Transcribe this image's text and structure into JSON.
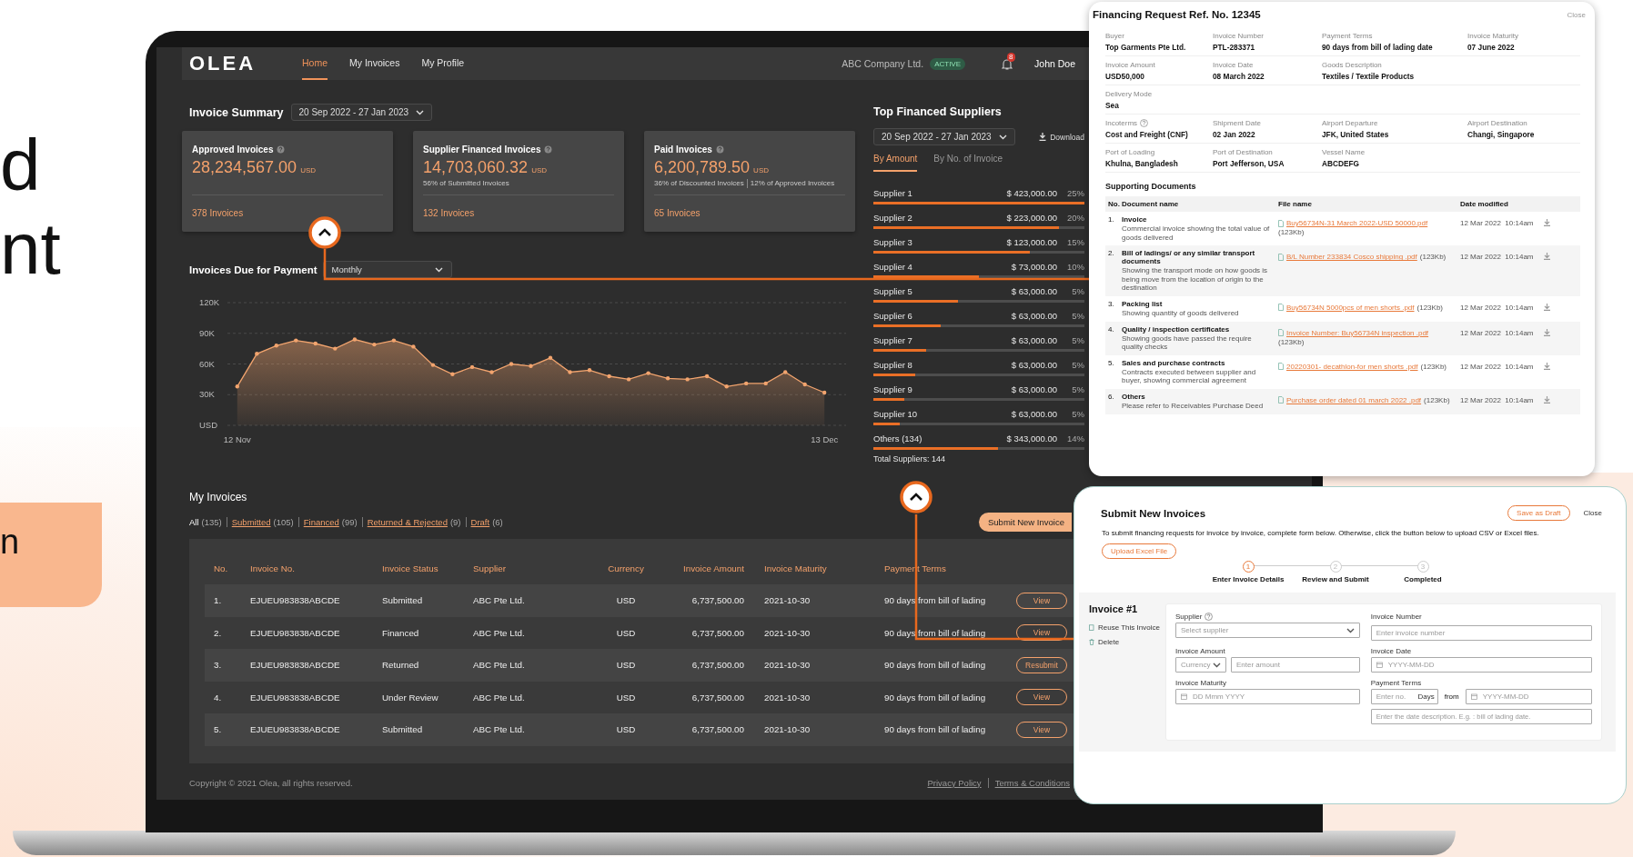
{
  "hero": {
    "lines": [
      "d",
      "nt"
    ],
    "highlight": "n"
  },
  "nav": {
    "logo": "OLEA",
    "tabs": [
      {
        "label": "Home",
        "selected": true
      },
      {
        "label": "My Invoices",
        "selected": false
      },
      {
        "label": "My Profile",
        "selected": false
      }
    ],
    "company": "ABC Company Ltd.",
    "status": "ACTIVE",
    "notifications": "8",
    "user": "John Doe"
  },
  "invoice_summary": {
    "title": "Invoice Summary",
    "date_range": "20 Sep 2022 - 27 Jan 2023",
    "cards": [
      {
        "title": "Approved Invoices",
        "amount": "28,234,567.00",
        "currency": "USD",
        "link": "378 Invoices"
      },
      {
        "title": "Supplier Financed Invoices",
        "amount": "14,703,060.32",
        "currency": "USD",
        "notes": [
          "56% of Submitted Invoices"
        ],
        "link": "132 Invoices"
      },
      {
        "title": "Paid Invoices",
        "amount": "6,200,789.50",
        "currency": "USD",
        "notes": [
          "36% of Discounted Invoices",
          "12% of Approved Invoices"
        ],
        "link": "65 Invoices"
      }
    ]
  },
  "invoices_due": {
    "title": "Invoices Due for Payment",
    "period": "Monthly",
    "chart_data": {
      "type": "area",
      "categories": [
        "12 Nov",
        null,
        null,
        null,
        null,
        null,
        null,
        null,
        null,
        null,
        null,
        null,
        null,
        null,
        null,
        null,
        null,
        null,
        null,
        null,
        null,
        null,
        null,
        null,
        null,
        null,
        null,
        null,
        null,
        null,
        "13 Dec"
      ],
      "series": [
        {
          "color": "#f2a46e",
          "values": [
            38000,
            70000,
            78000,
            83000,
            80000,
            75000,
            84000,
            79000,
            83000,
            77000,
            59000,
            50000,
            57000,
            52000,
            60000,
            58000,
            66000,
            52000,
            54000,
            48000,
            45000,
            51000,
            46000,
            45000,
            48000,
            38000,
            41000,
            41000,
            52000,
            40000,
            32000
          ]
        }
      ],
      "ylim": [
        0,
        120000
      ],
      "grid": true,
      "yticks": [
        {
          "value": 0,
          "label": "USD"
        },
        {
          "value": 30000,
          "label": "30K"
        },
        {
          "value": 60000,
          "label": "60K"
        },
        {
          "value": 90000,
          "label": "90K"
        },
        {
          "value": 120000,
          "label": "120K"
        }
      ]
    }
  },
  "top_suppliers": {
    "title": "Top Financed Suppliers",
    "date_range": "20 Sep 2022 - 27 Jan 2023",
    "download": "Download",
    "tabs": [
      {
        "label": "By Amount",
        "selected": true
      },
      {
        "label": "By No. of Invoice",
        "selected": false
      }
    ],
    "rows": [
      {
        "name": "Supplier 1",
        "amount": "$ 423,000.00",
        "share": "25%",
        "level": 1.0
      },
      {
        "name": "Supplier 2",
        "amount": "$ 223,000.00",
        "share": "20%",
        "level": 0.88
      },
      {
        "name": "Supplier 3",
        "amount": "$ 123,000.00",
        "share": "15%",
        "level": 0.74
      },
      {
        "name": "Supplier 4",
        "amount": "$ 73,000.00",
        "share": "10%",
        "level": 0.5
      },
      {
        "name": "Supplier 5",
        "amount": "$ 63,000.00",
        "share": "5%",
        "level": 0.4
      },
      {
        "name": "Supplier 6",
        "amount": "$ 63,000.00",
        "share": "5%",
        "level": 0.32
      },
      {
        "name": "Supplier 7",
        "amount": "$ 63,000.00",
        "share": "5%",
        "level": 0.25
      },
      {
        "name": "Supplier 8",
        "amount": "$ 63,000.00",
        "share": "5%",
        "level": 0.2
      },
      {
        "name": "Supplier 9",
        "amount": "$ 63,000.00",
        "share": "5%",
        "level": 0.145
      },
      {
        "name": "Supplier 10",
        "amount": "$ 63,000.00",
        "share": "5%",
        "level": 0.125
      },
      {
        "name": "Others (134)",
        "amount": "$ 343,000.00",
        "share": "14%",
        "level": 0.59
      }
    ],
    "total": "Total Suppliers: 144"
  },
  "my_invoices": {
    "title": "My Invoices",
    "filters": [
      {
        "label": "All",
        "count": "(135)",
        "selected": true
      },
      {
        "label": "Submitted",
        "count": "(105)",
        "selected": false
      },
      {
        "label": "Financed",
        "count": "(99)",
        "selected": false
      },
      {
        "label": "Returned & Rejected",
        "count": "(9)",
        "selected": false
      },
      {
        "label": "Draft",
        "count": "(6)",
        "selected": false
      }
    ],
    "submit_button": "Submit New Invoice",
    "columns": [
      "No.",
      "Invoice No.",
      "Invoice Status",
      "Supplier",
      "Currency",
      "Invoice Amount",
      "Invoice Maturity",
      "Payment Terms"
    ],
    "rows": [
      {
        "cells": [
          "1.",
          "EJUEU983838ABCDE",
          "Submitted",
          "ABC Pte Ltd.",
          "USD",
          "6,737,500.00",
          "2021-10-30",
          "90 days from bill of lading"
        ],
        "action": "View"
      },
      {
        "cells": [
          "2.",
          "EJUEU983838ABCDE",
          "Financed",
          "ABC Pte Ltd.",
          "USD",
          "6,737,500.00",
          "2021-10-30",
          "90 days from bill of lading"
        ],
        "action": "View"
      },
      {
        "cells": [
          "3.",
          "EJUEU983838ABCDE",
          "Returned",
          "ABC Pte Ltd.",
          "USD",
          "6,737,500.00",
          "2021-10-30",
          "90 days from bill of lading"
        ],
        "action": "Resubmit"
      },
      {
        "cells": [
          "4.",
          "EJUEU983838ABCDE",
          "Under Review",
          "ABC Pte Ltd.",
          "USD",
          "6,737,500.00",
          "2021-10-30",
          "90 days from bill of lading"
        ],
        "action": "View"
      },
      {
        "cells": [
          "5.",
          "EJUEU983838ABCDE",
          "Submitted",
          "ABC Pte Ltd.",
          "USD",
          "6,737,500.00",
          "2021-10-30",
          "90 days from bill of lading"
        ],
        "action": "View"
      }
    ]
  },
  "footer": {
    "copyright": "Copyright © 2021 Olea, all rights reserved.",
    "links": [
      "Privacy Policy",
      "Terms & Conditions"
    ]
  },
  "financing_request": {
    "title": "Financing Request Ref. No. 12345",
    "close": "Close",
    "field_rows": [
      {
        "fields": [
          {
            "label": "Buyer",
            "value": "Top Garments Pte Ltd.",
            "help": false
          },
          {
            "label": "Invoice Number",
            "value": "PTL-283371",
            "help": false
          },
          {
            "label": "Payment Terms",
            "value": "90 days from bill of lading date",
            "help": false
          },
          {
            "label": "Invoice Maturity",
            "value": "07 June 2022",
            "help": false
          }
        ]
      },
      {
        "fields": [
          {
            "label": "Invoice Amount",
            "value": "USD50,000",
            "help": false
          },
          {
            "label": "Invoice Date",
            "value": "08 March 2022",
            "help": false
          },
          {
            "label": "Goods Description",
            "value": "Textiles / Textile Products",
            "help": false
          }
        ]
      },
      {
        "fields": [
          {
            "label": "Delivery Mode",
            "value": "Sea",
            "help": false
          }
        ]
      },
      {
        "fields": [
          {
            "label": "Incoterms",
            "value": "Cost and Freight  (CNF)",
            "help": true
          },
          {
            "label": "Shipment Date",
            "value": "02 Jan 2022",
            "help": false
          },
          {
            "label": "Airport Departure",
            "value": "JFK, United States",
            "help": false
          },
          {
            "label": "Airport Destination",
            "value": "Changi, Singapore",
            "help": false
          }
        ]
      },
      {
        "fields": [
          {
            "label": "Port of Loading",
            "value": "Khulna, Bangladesh",
            "help": false
          },
          {
            "label": "Port of Destination",
            "value": "Port Jefferson, USA",
            "help": false
          },
          {
            "label": "Vessel Name",
            "value": "ABCDEFG",
            "help": false
          }
        ]
      }
    ],
    "documents_title": "Supporting Documents",
    "document_columns": [
      "No.",
      "Document name",
      "File name",
      "Date modified"
    ],
    "documents": [
      {
        "no": "1.",
        "name": "Invoice",
        "description": "Commercial invoice showing the total value of goods delivered",
        "file": "Buy56734N-31 March 2022-USD 50000.pdf",
        "size": "(123Kb)",
        "date": "12 Mar 2022  10:14am"
      },
      {
        "no": "2.",
        "name": "Bill of ladings/ or any similar transport documents",
        "description": "Showing the transport mode on how goods is being move from the location of origin to the destination",
        "file": "B/L Number 233834 Cosco shipping .pdf",
        "size": "(123Kb)",
        "date": "12 Mar 2022  10:14am"
      },
      {
        "no": "3.",
        "name": "Packing list",
        "description": "Showing quantity of goods delivered",
        "file": "Buy56734N 5000pcs of men shorts .pdf",
        "size": "(123Kb)",
        "date": "12 Mar 2022  10:14am"
      },
      {
        "no": "4.",
        "name": "Quality / inspection certificates",
        "description": "Showing goods have passed the require quality checks",
        "file": "Invoice Number: Buy56734N inspection .pdf",
        "size": "(123Kb)",
        "date": "12 Mar 2022  10:14am"
      },
      {
        "no": "5.",
        "name": "Sales and purchase contracts",
        "description": "Contracts executed between supplier and buyer, showing commercial agreement",
        "file": "20220301- decathlon-for men shorts .pdf",
        "size": "(123Kb)",
        "date": "12 Mar 2022  10:14am"
      },
      {
        "no": "6.",
        "name": "Others",
        "description": "Please refer to Receivables Purchase Deed",
        "file": "Purchase order dated 01 march 2022 .pdf",
        "size": "(123Kb)",
        "date": "12 Mar 2022  10:14am"
      }
    ]
  },
  "submit_invoices": {
    "title": "Submit New Invoices",
    "save_draft": "Save as Draft",
    "close": "Close",
    "description": "To submit financing requests for invoice by invoice,  complete form below. Otherwise, click the button below to upload CSV or Excel files.",
    "upload": "Upload Excel File",
    "steps": [
      {
        "number": "1",
        "label": "Enter Invoice Details",
        "selected": true
      },
      {
        "number": "2",
        "label": "Review and Submit",
        "selected": false
      },
      {
        "number": "3",
        "label": "Completed",
        "selected": false
      }
    ],
    "invoice_title": "Invoice #1",
    "actions": [
      {
        "label": "Reuse This Invoice",
        "kind": "copy"
      },
      {
        "label": "Delete",
        "kind": "delete"
      }
    ],
    "supplier": {
      "label": "Supplier",
      "placeholder": "Select supplier"
    },
    "invoice_number": {
      "label": "Invoice Number",
      "placeholder": "Enter invoice number"
    },
    "invoice_amount": {
      "label": "Invoice Amount",
      "currency_placeholder": "Currency",
      "placeholder": "Enter amount"
    },
    "invoice_date": {
      "label": "Invoice Date",
      "placeholder": "YYYY-MM-DD"
    },
    "invoice_maturity": {
      "label": "Invoice Maturity",
      "placeholder": "DD Mmm YYYY"
    },
    "payment_terms": {
      "label": "Payment Terms",
      "days_placeholder": "Enter no.",
      "days_unit": "Days",
      "from": "from",
      "date_placeholder": "YYYY-MM-DD",
      "description_placeholder": "Enter the date description. E.g. : bill of lading date."
    }
  }
}
